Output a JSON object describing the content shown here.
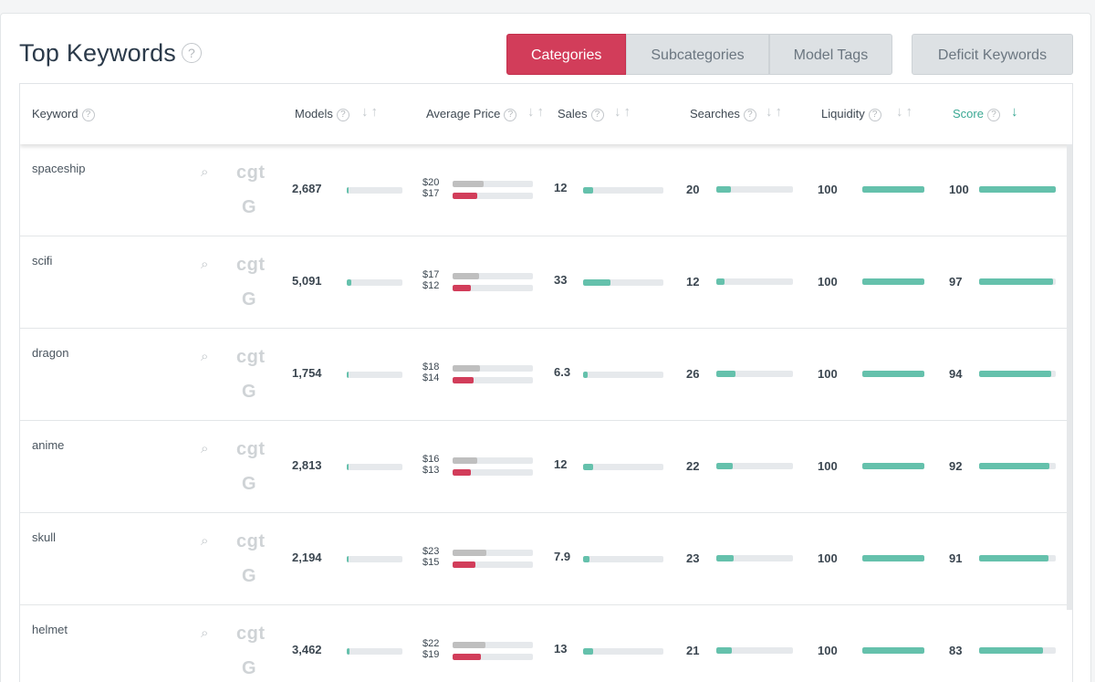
{
  "header": {
    "title": "Top Keywords",
    "help": "?"
  },
  "tabs": [
    {
      "label": "Categories",
      "active": true
    },
    {
      "label": "Subcategories",
      "active": false
    },
    {
      "label": "Model Tags",
      "active": false
    }
  ],
  "deficit_button": "Deficit Keywords",
  "columns": {
    "keyword": "Keyword",
    "models": "Models",
    "avg_price": "Average Price",
    "sales": "Sales",
    "searches": "Searches",
    "liquidity": "Liquidity",
    "score": "Score"
  },
  "sort_arrows": {
    "down": "↓",
    "up": "↑"
  },
  "row_icons": {
    "search": "⌕",
    "cgt": "cgt",
    "google": "G"
  },
  "colors": {
    "accent": "#d23d5a",
    "teal": "#65c1ac",
    "price_high": "#bfbfbf",
    "price_low": "#d23d5a"
  },
  "rows": [
    {
      "keyword": "spaceship",
      "models": "2,687",
      "price_high": "$20",
      "price_low": "$17",
      "sales": "12",
      "searches": "20",
      "liquidity": "100",
      "score": "100",
      "models_pct": 0.03,
      "price_high_pct": 0.39,
      "price_low_pct": 0.31,
      "sales_pct": 0.13,
      "searches_pct": 0.19,
      "liquidity_pct": 1.0,
      "score_pct": 1.0
    },
    {
      "keyword": "scifi",
      "models": "5,091",
      "price_high": "$17",
      "price_low": "$12",
      "sales": "33",
      "searches": "12",
      "liquidity": "100",
      "score": "97",
      "models_pct": 0.08,
      "price_high_pct": 0.33,
      "price_low_pct": 0.23,
      "sales_pct": 0.34,
      "searches_pct": 0.11,
      "liquidity_pct": 1.0,
      "score_pct": 0.97
    },
    {
      "keyword": "dragon",
      "models": "1,754",
      "price_high": "$18",
      "price_low": "$14",
      "sales": "6.3",
      "searches": "26",
      "liquidity": "100",
      "score": "94",
      "models_pct": 0.02,
      "price_high_pct": 0.34,
      "price_low_pct": 0.26,
      "sales_pct": 0.06,
      "searches_pct": 0.25,
      "liquidity_pct": 1.0,
      "score_pct": 0.94
    },
    {
      "keyword": "anime",
      "models": "2,813",
      "price_high": "$16",
      "price_low": "$13",
      "sales": "12",
      "searches": "22",
      "liquidity": "100",
      "score": "92",
      "models_pct": 0.04,
      "price_high_pct": 0.31,
      "price_low_pct": 0.23,
      "sales_pct": 0.12,
      "searches_pct": 0.21,
      "liquidity_pct": 1.0,
      "score_pct": 0.92
    },
    {
      "keyword": "skull",
      "models": "2,194",
      "price_high": "$23",
      "price_low": "$15",
      "sales": "7.9",
      "searches": "23",
      "liquidity": "100",
      "score": "91",
      "models_pct": 0.03,
      "price_high_pct": 0.42,
      "price_low_pct": 0.28,
      "sales_pct": 0.08,
      "searches_pct": 0.23,
      "liquidity_pct": 1.0,
      "score_pct": 0.91
    },
    {
      "keyword": "helmet",
      "models": "3,462",
      "price_high": "$22",
      "price_low": "$19",
      "sales": "13",
      "searches": "21",
      "liquidity": "100",
      "score": "83",
      "models_pct": 0.05,
      "price_high_pct": 0.41,
      "price_low_pct": 0.35,
      "sales_pct": 0.13,
      "searches_pct": 0.2,
      "liquidity_pct": 1.0,
      "score_pct": 0.83
    }
  ]
}
